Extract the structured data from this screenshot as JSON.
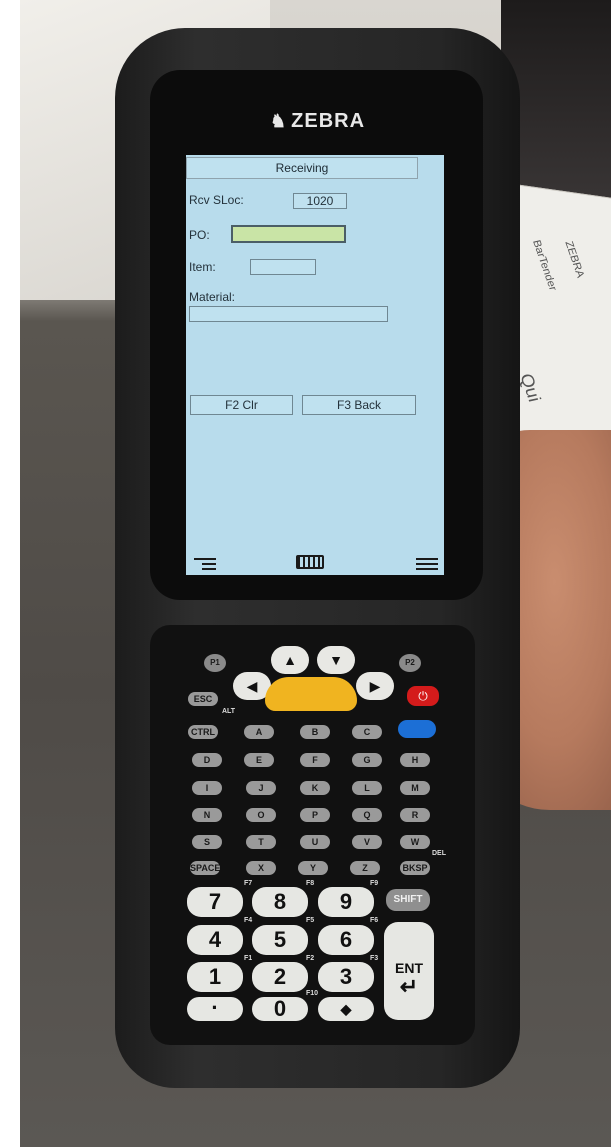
{
  "device": {
    "brand": "ZEBRA",
    "brand_logo_icon": "zebra-head-icon"
  },
  "screen": {
    "title": "Receiving",
    "fields": {
      "rcv_sloc_label": "Rcv SLoc:",
      "rcv_sloc_value": "1020",
      "po_label": "PO:",
      "po_value": "",
      "item_label": "Item:",
      "item_value": "",
      "material_label": "Material:",
      "material_value": ""
    },
    "buttons": {
      "f2": "F2 Clr",
      "f3": "F3 Back"
    },
    "colors": {
      "background": "#b8dcec",
      "active_field": "#c9e4a6"
    }
  },
  "keypad": {
    "p1": "P1",
    "p2": "P2",
    "esc": "ESC",
    "alt": "ALT",
    "ctrl": "CTRL",
    "space": "SPACE",
    "bksp": "BKSP",
    "shift": "SHIFT",
    "del": "DEL",
    "ent": "ENT",
    "ent_symbol": "↵",
    "letters": [
      "A",
      "B",
      "C",
      "D",
      "E",
      "F",
      "G",
      "H",
      "I",
      "J",
      "K",
      "L",
      "M",
      "N",
      "O",
      "P",
      "Q",
      "R",
      "S",
      "T",
      "U",
      "V",
      "W",
      "X",
      "Y",
      "Z"
    ],
    "digits": [
      "7",
      "8",
      "9",
      "4",
      "5",
      "6",
      "1",
      "2",
      "3",
      "·",
      "0",
      "◆"
    ],
    "f_labels": [
      "F7",
      "F8",
      "F9",
      "F4",
      "F5",
      "F6",
      "F1",
      "F2",
      "F3",
      "F10"
    ],
    "colors": {
      "yellow_scan": "#f0b420",
      "power_red": "#d41b1b",
      "blue_fn": "#1c6fd6"
    }
  },
  "background": {
    "label_text_1": "BarTender",
    "label_text_2": "ZEBRA",
    "label_text_3": "Qui"
  }
}
